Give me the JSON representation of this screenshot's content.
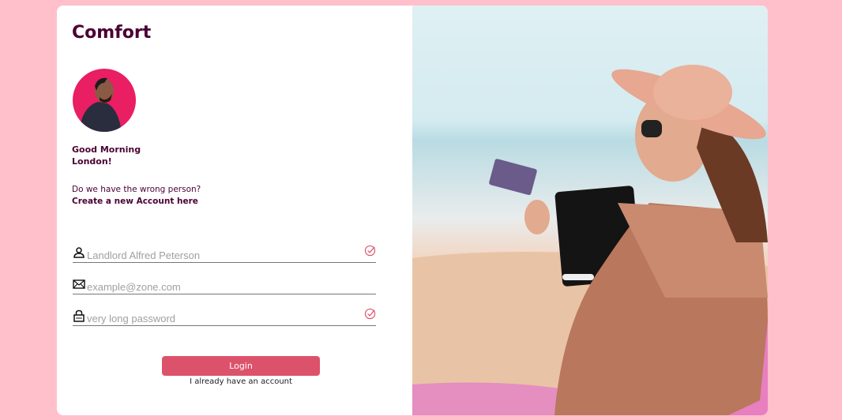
{
  "brand": "Comfort",
  "greeting": {
    "line1": "Good Morning",
    "line2": "London!"
  },
  "wrong_person": {
    "question": "Do we have the wrong person?",
    "link": "Create a new Account here"
  },
  "form": {
    "name_placeholder": "Landlord Alfred Peterson",
    "email_placeholder": "example@zone.com",
    "password_placeholder": "very long password"
  },
  "login_label": "Login",
  "have_account": "I already have an account",
  "colors": {
    "background": "#ffc0cb",
    "accent": "#dd526b",
    "brand": "#4a0033"
  }
}
